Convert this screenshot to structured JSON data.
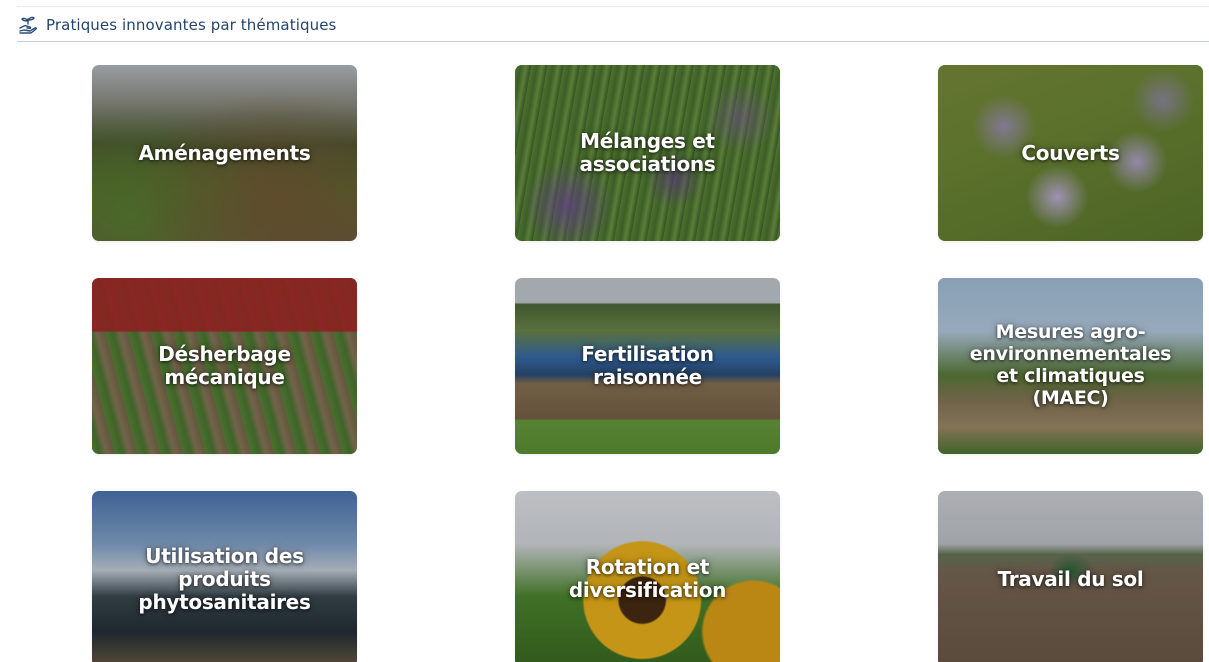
{
  "section": {
    "icon": "hand-plant-icon",
    "title": "Pratiques innovantes par thématiques"
  },
  "colors": {
    "header_text": "#23456f",
    "card_text": "#ffffff"
  },
  "cards": [
    {
      "label": "Aménagements"
    },
    {
      "label": "Mélanges et associations"
    },
    {
      "label": "Couverts"
    },
    {
      "label": "Désherbage mécanique"
    },
    {
      "label": "Fertilisation raisonnée"
    },
    {
      "label": "Mesures agro-environnementales et climatiques (MAEC)"
    },
    {
      "label": "Utilisation des produits phytosanitaires"
    },
    {
      "label": "Rotation et diversification"
    },
    {
      "label": "Travail du sol"
    }
  ]
}
